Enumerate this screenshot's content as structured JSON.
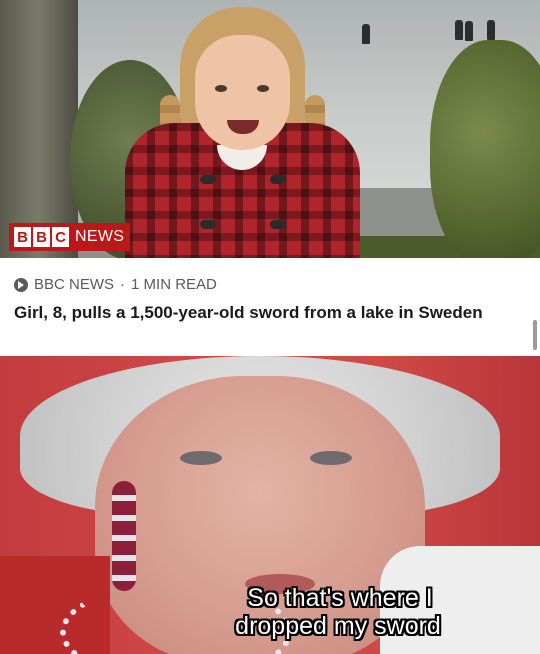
{
  "top_photo": {
    "logo": {
      "blocks": [
        "B",
        "B",
        "C"
      ],
      "label": "NEWS"
    },
    "colors": {
      "bbc_red": "#bb1919"
    }
  },
  "article_card": {
    "source": "BBC NEWS",
    "separator": "·",
    "read_time": "1 MIN READ",
    "icon": "share-arrow-icon",
    "headline": "Girl, 8, pulls a 1,500-year-old sword from a lake in Sweden"
  },
  "bottom_photo": {
    "caption_line1": "So that's where I",
    "caption_line2": "dropped my sword"
  }
}
